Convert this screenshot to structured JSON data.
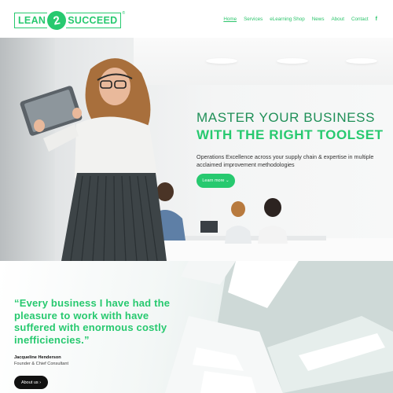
{
  "logo": {
    "left": "LEAN",
    "number": "2",
    "right": "SUCCEED",
    "tm": "®"
  },
  "nav": {
    "items": [
      "Home",
      "Services",
      "eLearning Shop",
      "News",
      "About",
      "Contact"
    ],
    "social": "f"
  },
  "hero": {
    "title_line1": "MASTER YOUR BUSINESS",
    "title_line2": "WITH THE RIGHT TOOLSET",
    "description": "Operations Excellence across your supply chain & expertise in multiple acclaimed improvement methodologies",
    "button_label": "Learn more ⌄"
  },
  "testimonial": {
    "quote": "“Every business I have had the pleasure to work with have suffered with enormous costly inefficiencies.”",
    "author": "Jacqueline Henderson",
    "role": "Founder & Chief Consultant",
    "button_label": "About us ›"
  },
  "colors": {
    "brand_green": "#27c96f",
    "dark_green": "#1f8f57",
    "button_dark": "#111111"
  },
  "icons": {
    "facebook": "facebook-icon",
    "chevron": "chevron-down-icon"
  }
}
